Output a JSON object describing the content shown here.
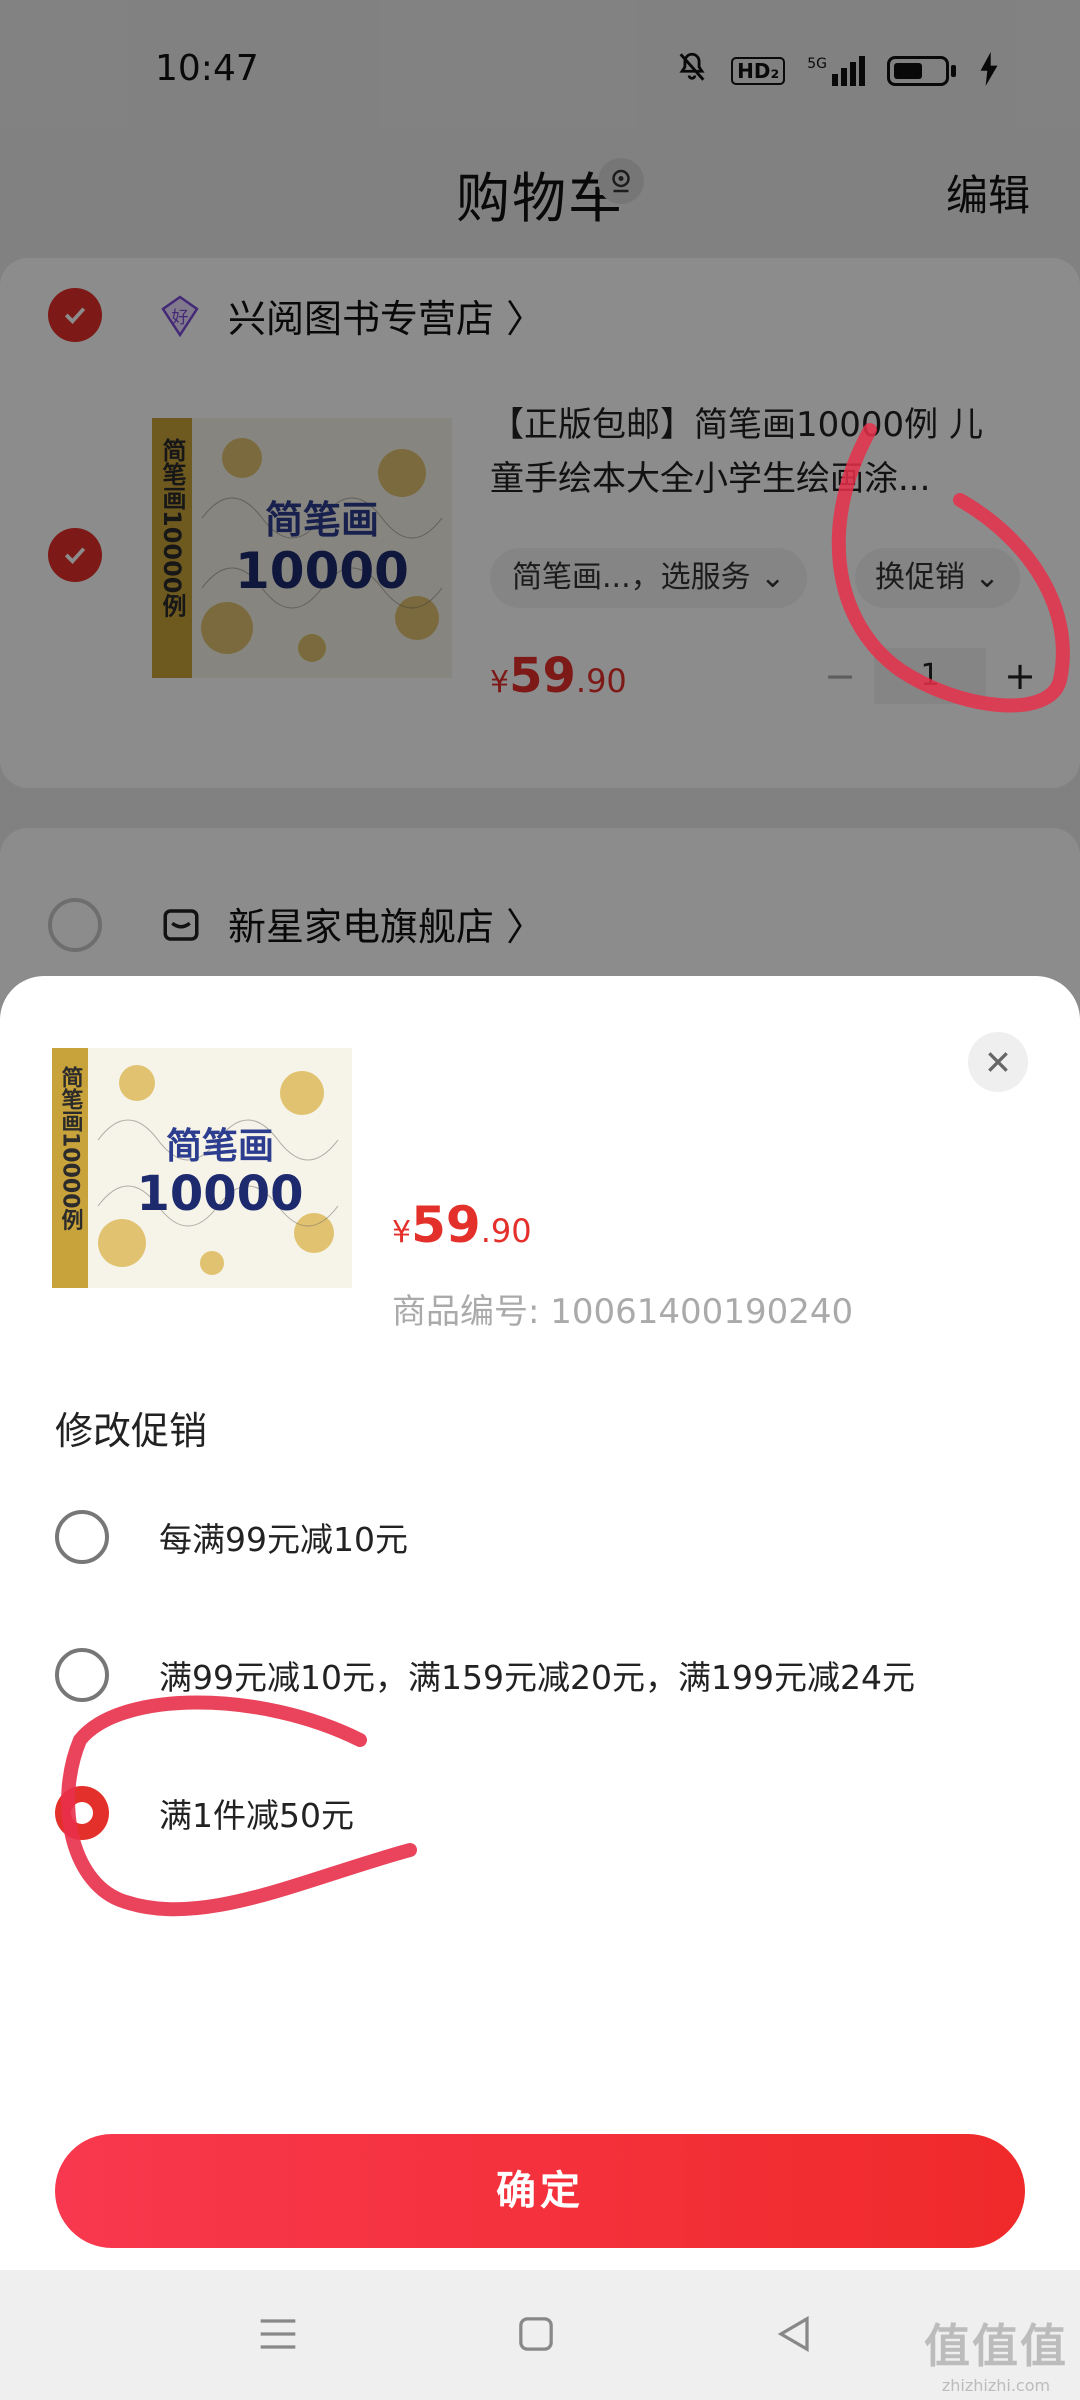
{
  "status_bar": {
    "time": "10:47",
    "hd": "HD₂",
    "network": "5G"
  },
  "header": {
    "title": "购物车",
    "edit": "编辑"
  },
  "shop1": {
    "badge": "好",
    "name": "兴阅图书专营店 〉",
    "item": {
      "title": "【正版包邮】简笔画10000例 儿童手绘本大全小学生绘画涂...",
      "spec": "简笔画...，选服务 ⌄",
      "promo": "换促销 ⌄",
      "price_yen": "¥",
      "price_int": "59",
      "price_dec": ".90",
      "minus": "−",
      "quantity": "1",
      "plus": "+",
      "book_cover_text": "简笔画",
      "book_cover_num": "10000",
      "book_spine_text": "简笔画10000例"
    }
  },
  "shop2": {
    "name": "新星家电旗舰店 〉"
  },
  "sheet": {
    "price_yen": "¥",
    "price_int": "59",
    "price_dec": ".90",
    "sku": "商品编号: 10061400190240",
    "section_title": "修改促销",
    "options": [
      {
        "label": "每满99元减10元",
        "selected": false
      },
      {
        "label": "满99元减10元，满159元减20元，满199元减24元",
        "selected": false
      },
      {
        "label": "满1件减50元",
        "selected": true
      }
    ],
    "confirm": "确定"
  },
  "watermark": {
    "main": "值值值",
    "sub": "zhizhizhi.com"
  },
  "colors": {
    "accent": "#e4302b",
    "button_gradient_start": "#f8384e",
    "button_gradient_end": "#f02a2a",
    "annotation": "#e8304a"
  },
  "icons": [
    "mute-icon",
    "hd-icon",
    "signal-icon",
    "battery-icon",
    "charging-icon",
    "location-icon",
    "check-icon",
    "good-shop-badge-icon",
    "store-icon",
    "chevron-right-icon",
    "close-icon",
    "menu-icon",
    "home-icon",
    "back-icon"
  ]
}
